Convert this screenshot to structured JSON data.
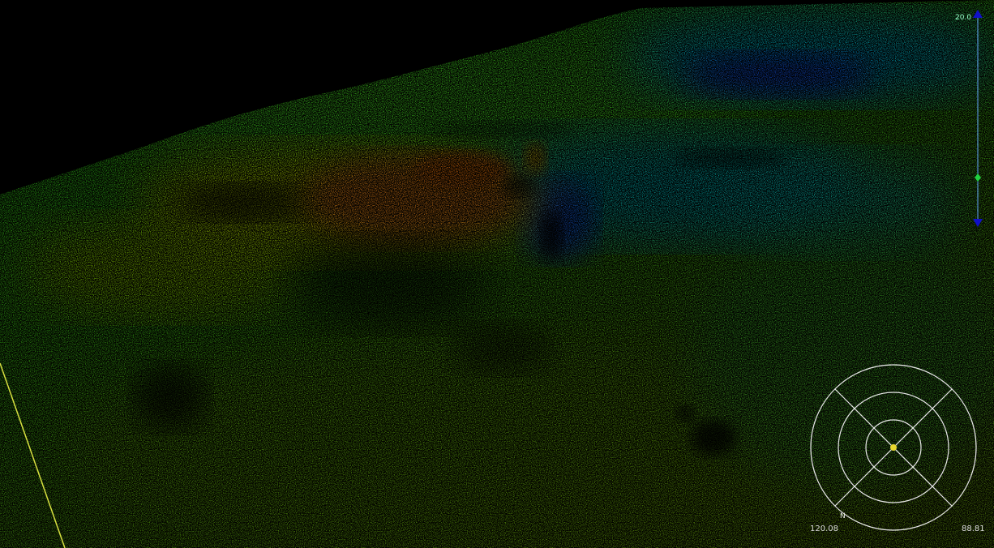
{
  "viewer": {
    "readout_left": "120.08",
    "readout_right": "88.81",
    "north_label": "N",
    "scale_top_label": "20.0"
  },
  "colors": {
    "background": "#000000",
    "deep": "#0018e0",
    "mid_deep": "#00b0ff",
    "mid": "#22e840",
    "mid_shallow": "#c8f000",
    "shallow": "#ff8a1a",
    "compass_ring": "#e8e8e8",
    "compass_center": "#e8d830",
    "scale_marker": "#1010c8",
    "scale_line": "#66aaff",
    "scale_mid_marker": "#20d040",
    "guide_line": "#d8e040"
  },
  "icons": {
    "compass": "compass-rose-icon",
    "scale_top": "triangle-up-icon",
    "scale_bottom": "triangle-down-icon",
    "scale_mid": "diamond-marker-icon"
  }
}
